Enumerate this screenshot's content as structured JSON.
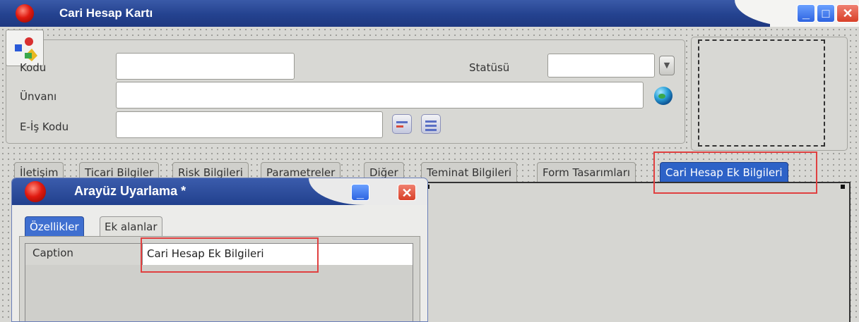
{
  "window": {
    "title": "Cari Hesap Kartı"
  },
  "form": {
    "kodu_label": "Kodu",
    "kodu_value": "",
    "statusu_label": "Statüsü",
    "statusu_value": "",
    "unvan_label": "Ünvanı",
    "unvan_value": "",
    "eis_label": "E-İş Kodu",
    "eis_value": ""
  },
  "tabs": [
    {
      "label": "İletişim"
    },
    {
      "label": "Ticari Bilgiler"
    },
    {
      "label": "Risk Bilgileri"
    },
    {
      "label": "Parametreler"
    },
    {
      "label": "Diğer"
    },
    {
      "label": "Teminat Bilgileri"
    },
    {
      "label": "Form Tasarımları"
    },
    {
      "label": "Cari Hesap Ek Bilgileri",
      "active": true
    }
  ],
  "dialog": {
    "title": "Arayüz Uyarlama *",
    "tabs": [
      {
        "label": "Özellikler",
        "active": true
      },
      {
        "label": "Ek alanlar"
      }
    ],
    "property": {
      "name": "Caption",
      "value": "Cari Hesap Ek Bilgileri"
    }
  },
  "colors": {
    "highlight": "#e04040",
    "active_tab": "#2d62c7",
    "titlebar": "#24428f"
  },
  "icons": [
    "app-icon",
    "combo-dropdown-icon",
    "globe-icon",
    "lookup-icon",
    "detail-icon",
    "minimize-icon",
    "maximize-icon",
    "close-icon"
  ]
}
